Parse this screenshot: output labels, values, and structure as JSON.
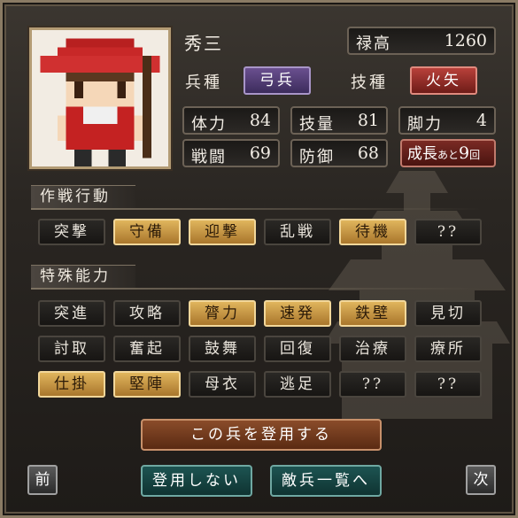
{
  "unit": {
    "name": "秀三",
    "stipend_label": "禄高",
    "stipend_value": "1260",
    "troop_label": "兵種",
    "troop_value": "弓兵",
    "skill_label": "技種",
    "skill_value": "火矢",
    "stats": [
      {
        "label": "体力",
        "value": "84"
      },
      {
        "label": "技量",
        "value": "81"
      },
      {
        "label": "脚力",
        "value": "4"
      },
      {
        "label": "戦闘",
        "value": "69"
      },
      {
        "label": "防御",
        "value": "68"
      }
    ],
    "growth": {
      "label": "成長",
      "ato": "あと",
      "count": "9",
      "unit": "回"
    }
  },
  "tactics": {
    "title": "作戦行動",
    "buttons": [
      {
        "label": "突撃",
        "active": false
      },
      {
        "label": "守備",
        "active": true
      },
      {
        "label": "迎撃",
        "active": true
      },
      {
        "label": "乱戦",
        "active": false
      },
      {
        "label": "待機",
        "active": true
      },
      {
        "label": "??",
        "active": false
      }
    ]
  },
  "abilities": {
    "title": "特殊能力",
    "buttons": [
      {
        "label": "突進",
        "active": false
      },
      {
        "label": "攻略",
        "active": false
      },
      {
        "label": "膂力",
        "active": true
      },
      {
        "label": "速発",
        "active": true
      },
      {
        "label": "鉄壁",
        "active": true
      },
      {
        "label": "見切",
        "active": false
      },
      {
        "label": "討取",
        "active": false
      },
      {
        "label": "奮起",
        "active": false
      },
      {
        "label": "鼓舞",
        "active": false
      },
      {
        "label": "回復",
        "active": false
      },
      {
        "label": "治療",
        "active": false
      },
      {
        "label": "療所",
        "active": false
      },
      {
        "label": "仕掛",
        "active": true
      },
      {
        "label": "堅陣",
        "active": true
      },
      {
        "label": "母衣",
        "active": false
      },
      {
        "label": "逃足",
        "active": false
      },
      {
        "label": "??",
        "active": false
      },
      {
        "label": "??",
        "active": false
      }
    ]
  },
  "actions": {
    "recruit": "この兵を登用する",
    "decline": "登用しない",
    "enemy_list": "敵兵一覧へ",
    "prev": "前",
    "next": "次"
  }
}
